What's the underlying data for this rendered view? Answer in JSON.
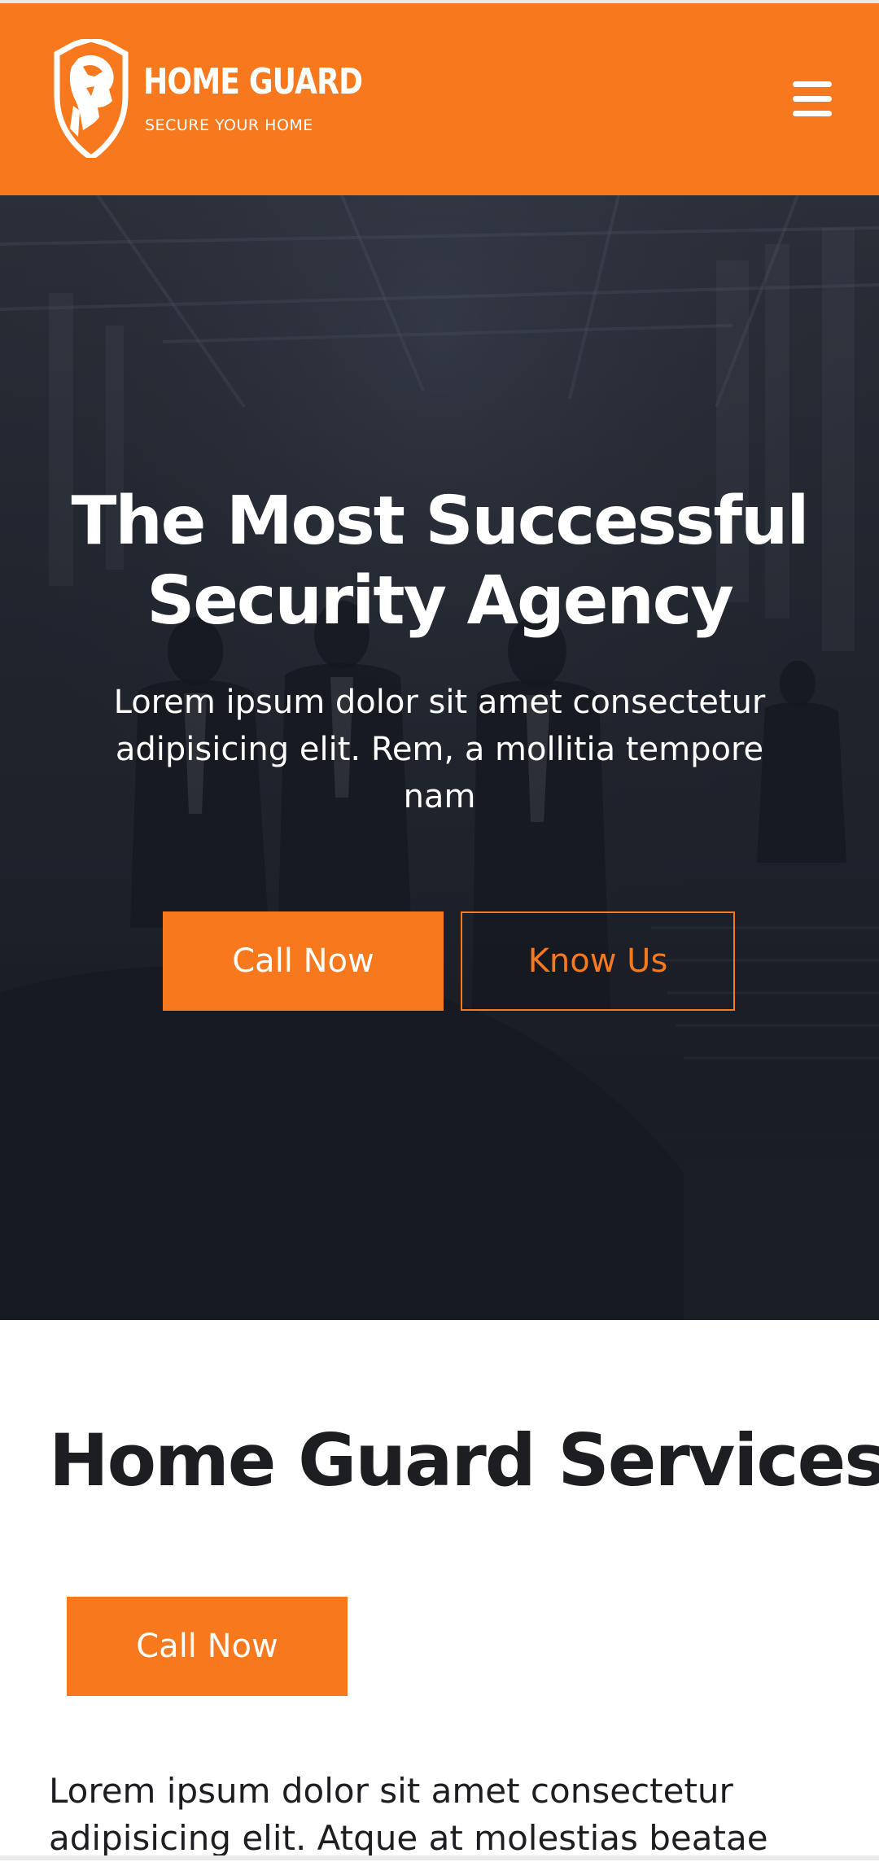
{
  "header": {
    "brand_name": "HOME GUARD",
    "brand_tagline": "SECURE YOUR HOME",
    "logo_icon": "lion-shield-icon",
    "menu_icon": "hamburger-menu-icon",
    "background_color": "#f8781d"
  },
  "hero": {
    "title": "The Most Successful Security Agency",
    "subtitle": "Lorem ipsum dolor sit amet consectetur adipisicing elit. Rem, a mollitia tempore nam",
    "primary_button_label": "Call Now",
    "secondary_button_label": "Know Us"
  },
  "services": {
    "title": "Home Guard Services",
    "call_button_label": "Call Now",
    "body": "Lorem ipsum dolor sit amet consectetur adipisicing elit. Atque at molestias beatae"
  },
  "colors": {
    "accent": "#f8781d",
    "text_dark": "#1d1e22",
    "white": "#ffffff"
  }
}
